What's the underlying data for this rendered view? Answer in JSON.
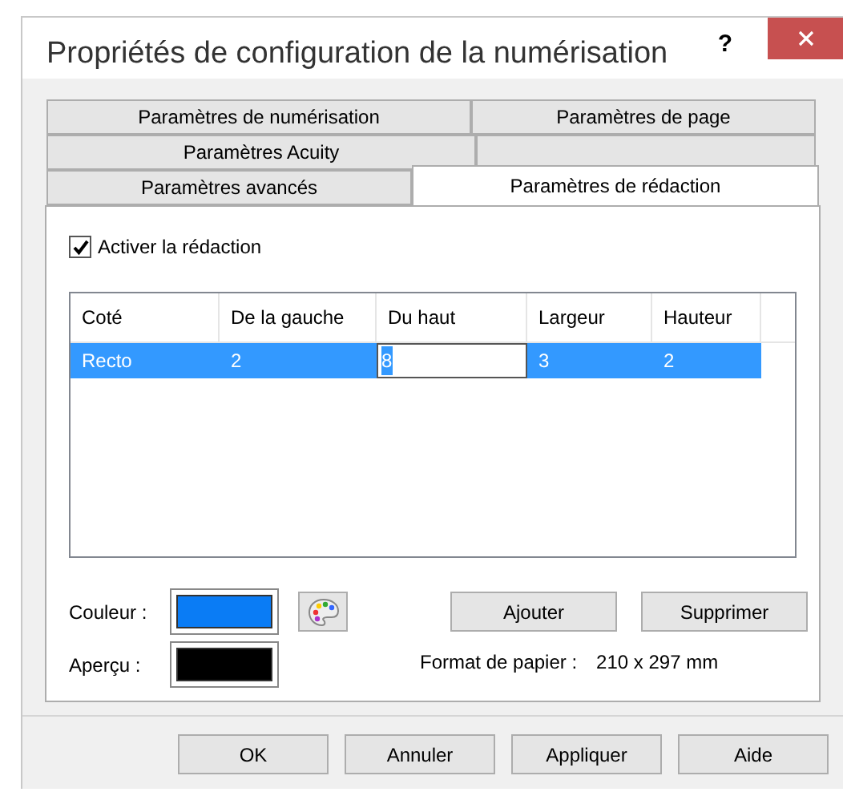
{
  "window": {
    "title": "Propriétés de configuration de la numérisation",
    "help": "?"
  },
  "tab_rows": [
    [
      {
        "label": "Paramètres de numérisation",
        "selected": false
      },
      {
        "label": "Paramètres de page",
        "selected": false
      }
    ],
    [
      {
        "label": "Paramètres Acuity",
        "selected": false
      },
      {
        "selected": false
      }
    ],
    [
      {
        "label": "Paramètres avancés",
        "selected": false
      },
      {
        "label": "Paramètres de rédaction",
        "selected": true
      }
    ]
  ],
  "enable_checkbox": {
    "label": "Activer la rédaction",
    "checked": true
  },
  "table": {
    "columns": [
      "Coté",
      "De la gauche",
      "Du haut",
      "Largeur",
      "Hauteur"
    ],
    "rows": [
      {
        "selected": true,
        "cells": [
          {
            "text": "Recto",
            "editing": false
          },
          {
            "text": "2",
            "editing": false
          },
          {
            "text": "8",
            "editing": true
          },
          {
            "text": "3",
            "editing": false
          },
          {
            "text": "2",
            "editing": false
          }
        ]
      }
    ]
  },
  "swatches": [
    {
      "label": "Couleur :",
      "color": "#0a7cf5",
      "picker": true
    },
    {
      "label": "Aperçu :",
      "color": "#000000",
      "picker": false
    }
  ],
  "actions": [
    "Ajouter",
    "Supprimer"
  ],
  "paper": {
    "label": "Format de papier :",
    "value": "210 x 297 mm"
  },
  "buttons": [
    "OK",
    "Annuler",
    "Appliquer",
    "Aide"
  ]
}
